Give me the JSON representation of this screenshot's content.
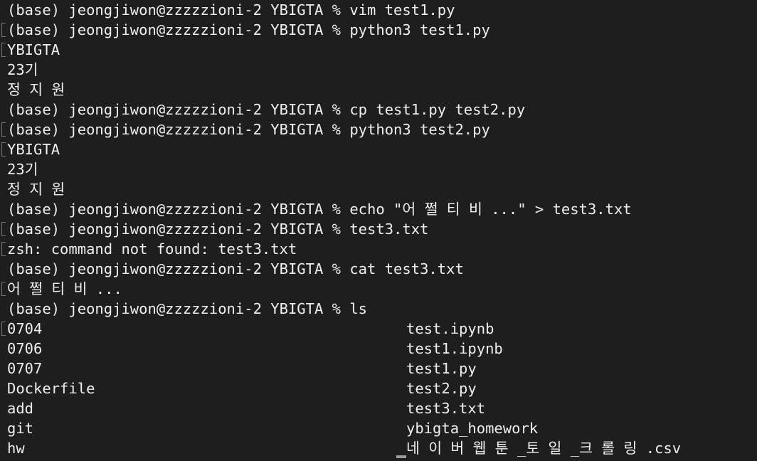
{
  "terminal": {
    "lines": [
      {
        "text": "(base) jeongjiwon@zzzzzioni-2 YBIGTA % vim test1.py",
        "mark": false
      },
      {
        "text": "(base) jeongjiwon@zzzzzioni-2 YBIGTA % python3 test1.py",
        "mark": true
      },
      {
        "text": "YBIGTA",
        "mark": true
      },
      {
        "text": "23기",
        "mark": false
      },
      {
        "text": "정 지 원",
        "mark": false
      },
      {
        "text": "(base) jeongjiwon@zzzzzioni-2 YBIGTA % cp test1.py test2.py",
        "mark": false
      },
      {
        "text": "(base) jeongjiwon@zzzzzioni-2 YBIGTA % python3 test2.py",
        "mark": true
      },
      {
        "text": "YBIGTA",
        "mark": true
      },
      {
        "text": "23기",
        "mark": false
      },
      {
        "text": "정 지 원",
        "mark": false
      },
      {
        "text": "(base) jeongjiwon@zzzzzioni-2 YBIGTA % echo \"어 쩔 티 비 ...\" > test3.txt",
        "mark": false
      },
      {
        "text": "(base) jeongjiwon@zzzzzioni-2 YBIGTA % test3.txt",
        "mark": true
      },
      {
        "text": "zsh: command not found: test3.txt",
        "mark": true
      },
      {
        "text": "(base) jeongjiwon@zzzzzioni-2 YBIGTA % cat test3.txt",
        "mark": false
      },
      {
        "text": "어 쩔 티 비 ...",
        "mark": true
      },
      {
        "text": "(base) jeongjiwon@zzzzzioni-2 YBIGTA % ls",
        "mark": false
      }
    ],
    "ls_output": [
      {
        "left": "0704",
        "right": "test.ipynb",
        "mark": true
      },
      {
        "left": "0706",
        "right": "test1.ipynb",
        "mark": false
      },
      {
        "left": "0707",
        "right": "test1.py",
        "mark": false
      },
      {
        "left": "Dockerfile",
        "right": "test2.py",
        "mark": false
      },
      {
        "left": "add",
        "right": "test3.txt",
        "mark": false
      },
      {
        "left": "git",
        "right": "ybigta_homework",
        "mark": false
      },
      {
        "left": "hw",
        "right": "네 이 버 웹 툰 _토 일 _크 롤 링 .csv",
        "mark": false
      }
    ]
  }
}
